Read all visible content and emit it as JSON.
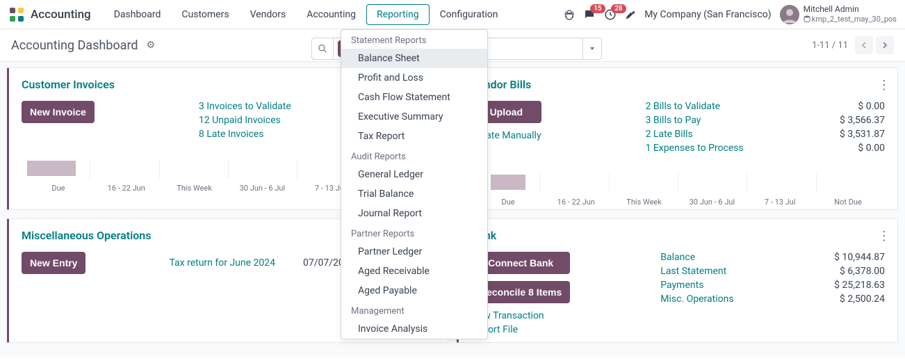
{
  "app_name": "Accounting",
  "nav": [
    "Dashboard",
    "Customers",
    "Vendors",
    "Accounting",
    "Reporting",
    "Configuration"
  ],
  "nav_active_index": 4,
  "msg_badge": "15",
  "act_badge": "28",
  "company": "My Company (San Francisco)",
  "user": {
    "name": "Mitchell Admin",
    "db": "kmp_2_test_may_30_pos"
  },
  "breadcrumb": "Accounting Dashboard",
  "pager": "1-11 / 11",
  "dropdown": {
    "sections": [
      {
        "header": "Statement Reports",
        "items": [
          "Balance Sheet",
          "Profit and Loss",
          "Cash Flow Statement",
          "Executive Summary",
          "Tax Report"
        ],
        "hover": 0
      },
      {
        "header": "Audit Reports",
        "items": [
          "General Ledger",
          "Trial Balance",
          "Journal Report"
        ]
      },
      {
        "header": "Partner Reports",
        "items": [
          "Partner Ledger",
          "Aged Receivable",
          "Aged Payable"
        ]
      },
      {
        "header": "Management",
        "items": [
          "Invoice Analysis"
        ]
      }
    ]
  },
  "axis": [
    "Due",
    "16 - 22 Jun",
    "This Week",
    "30 Jun - 6 Jul",
    "7 - 13 Jul",
    "Not Due"
  ],
  "axis2": [
    "Due",
    "16 - 22 Jun",
    "This Week",
    "30 Jun - 6 Jul",
    "7 - 13 Jul",
    "Not Due"
  ],
  "cards": {
    "invoices": {
      "title": "Customer Invoices",
      "button": "New Invoice",
      "links": [
        "3 Invoices to Validate",
        "12 Unpaid Invoices",
        "8 Late Invoices"
      ]
    },
    "bills": {
      "title": "Vendor Bills",
      "button": "Upload",
      "extra_link": "Create Manually",
      "links": [
        "2 Bills to Validate",
        "3 Bills to Pay",
        "2 Late Bills",
        "1 Expenses to Process"
      ],
      "values": [
        "$ 0.00",
        "$ 3,566.37",
        "$ 3,531.87",
        "$ 0.00"
      ]
    },
    "misc": {
      "title": "Miscellaneous Operations",
      "button": "New Entry",
      "link": "Tax return for June 2024",
      "date": "07/07/2024"
    },
    "bank": {
      "title": "Bank",
      "button1": "Connect Bank",
      "button2": "Reconcile 8 Items",
      "link1": "New Transaction",
      "link2": "Import File",
      "labels": [
        "Balance",
        "Last Statement",
        "Payments",
        "Misc. Operations"
      ],
      "values": [
        "$ 10,944.87",
        "$ 6,378.00",
        "$ 25,218.63",
        "$ 2,500.24"
      ]
    }
  }
}
